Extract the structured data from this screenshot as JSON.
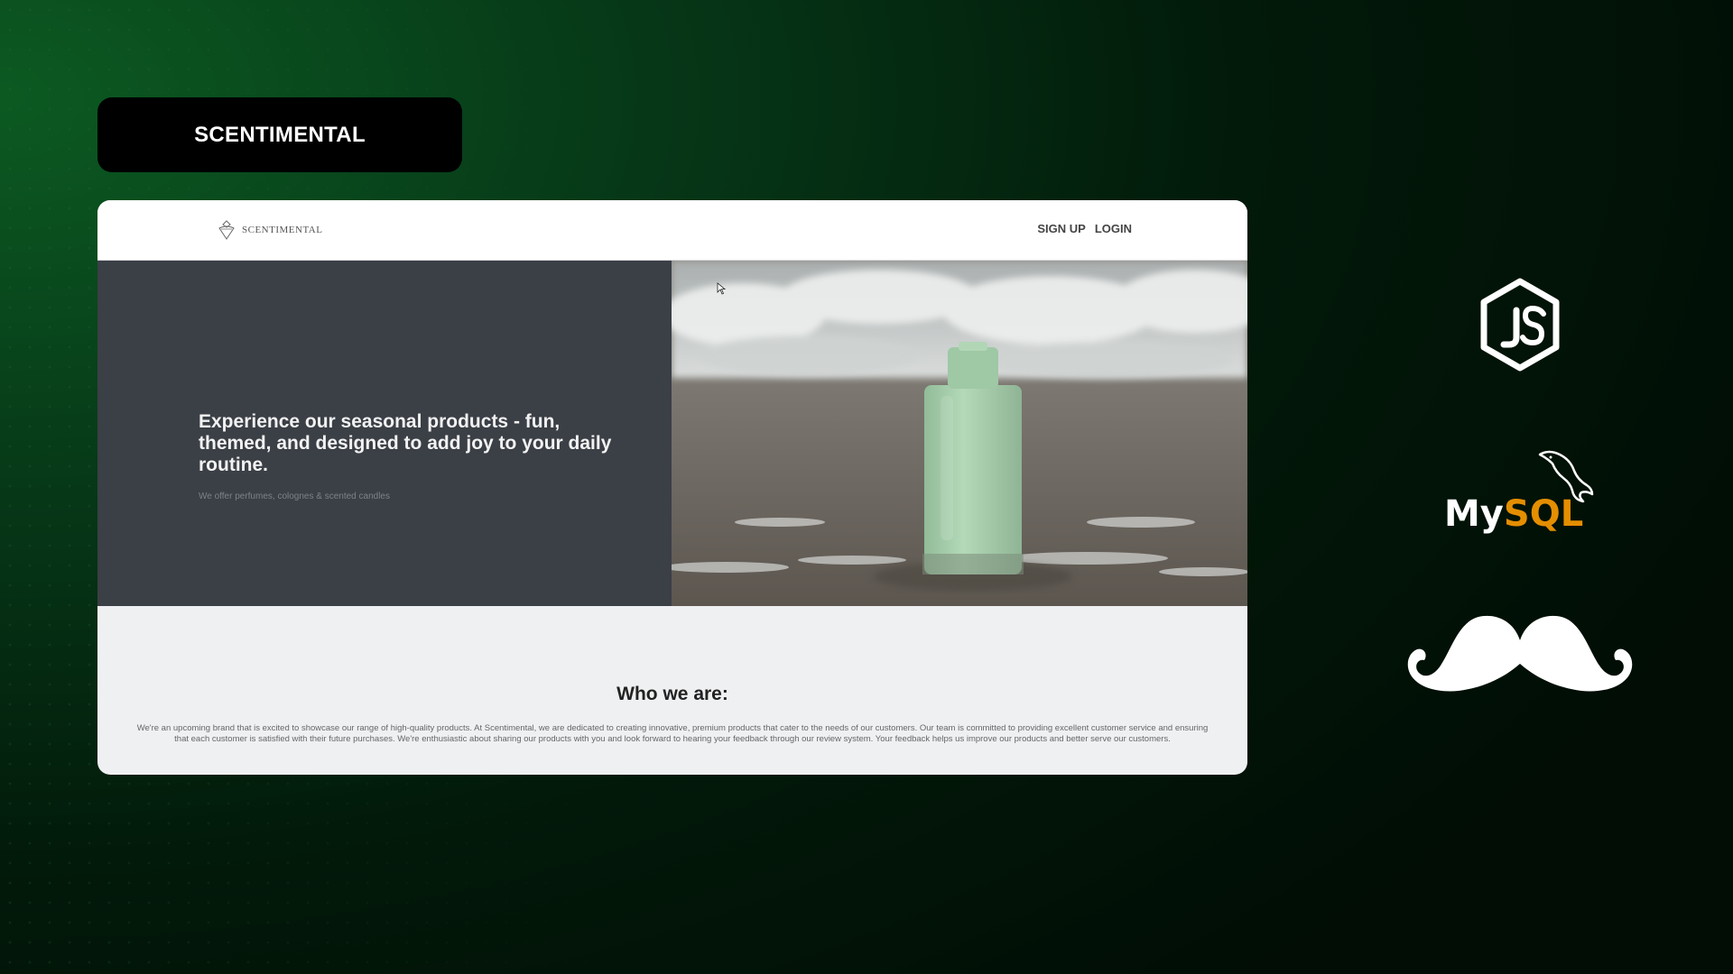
{
  "title_pill": {
    "label": "SCENTIMENTAL"
  },
  "site": {
    "logo_text": "SCENTIMENTAL",
    "nav": {
      "signup": "SIGN UP",
      "login": "LOGIN"
    },
    "hero": {
      "heading": "Experience our seasonal products - fun, themed, and designed to add joy to your daily routine.",
      "subtext": "We offer perfumes, colognes & scented candles"
    },
    "about": {
      "title": "Who we are:",
      "body": "We're an upcoming brand that is excited to showcase our range of high-quality products. At Scentimental, we are dedicated to creating innovative, premium products that cater to the needs of our customers. Our team is committed to providing excellent customer service and ensuring that each customer is satisfied with their future purchases. We're enthusiastic about sharing our products with you and look forward to hearing your feedback through our review system. Your feedback helps us improve our products and better serve our customers."
    }
  },
  "tech_stack": {
    "mysql_label_my": "My",
    "mysql_label_sql": "SQL"
  },
  "colors": {
    "background": "#021a0a",
    "hero_panel": "#3b3f46",
    "bottle": "#a8cfae",
    "mysql_orange": "#e48e00"
  },
  "icons": [
    "nodejs-icon",
    "mysql-dolphin-icon",
    "mustache-icon",
    "perfume-logo-icon",
    "cursor-icon"
  ]
}
